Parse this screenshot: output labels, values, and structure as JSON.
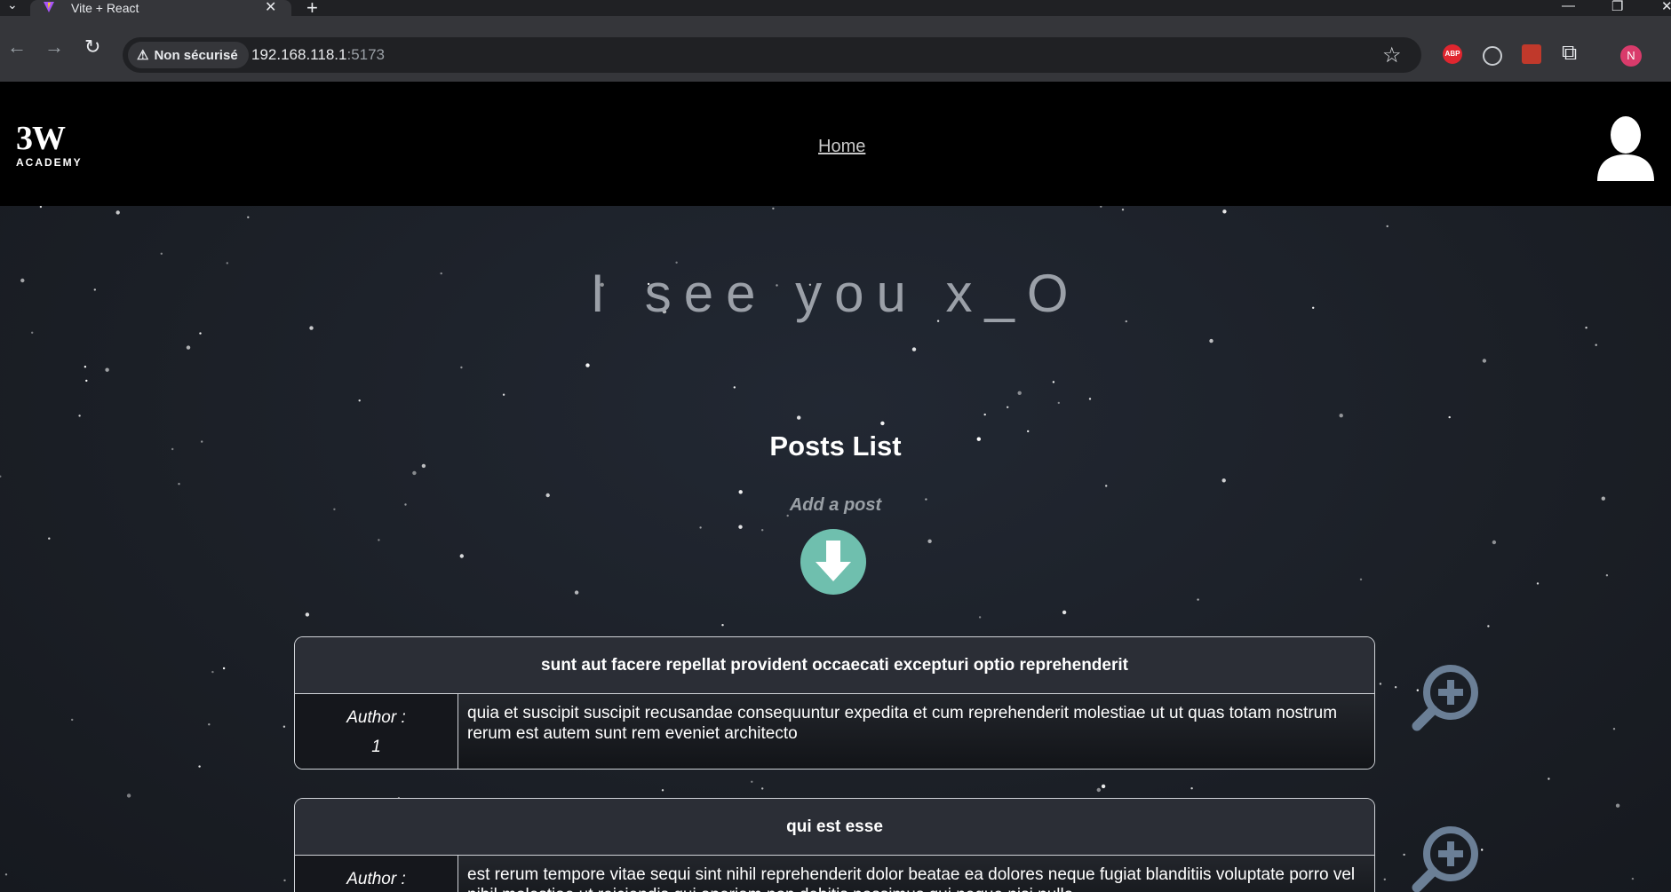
{
  "browser": {
    "tab_title": "Vite + React",
    "security_label": "Non sécurisé",
    "url_host": "192.168.118.1",
    "url_port": ":5173",
    "profile_initial": "N",
    "abp_label": "ABP"
  },
  "header": {
    "logo_mark": "3W",
    "logo_sub": "ACADEMY",
    "nav_home": "Home"
  },
  "hero": {
    "text": "I see you x_O"
  },
  "posts": {
    "title": "Posts List",
    "add_label": "Add a post",
    "items": [
      {
        "title": "sunt aut facere repellat provident occaecati excepturi optio reprehenderit",
        "author_label": "Author :",
        "author_id": "1",
        "body": "quia et suscipit suscipit recusandae consequuntur expedita et cum reprehenderit molestiae ut ut quas totam nostrum rerum est autem sunt rem eveniet architecto"
      },
      {
        "title": "qui est esse",
        "author_label": "Author :",
        "author_id": "",
        "body": "est rerum tempore vitae sequi sint nihil reprehenderit dolor beatae ea dolores neque fugiat blanditiis voluptate porro vel nihil molestiae ut reiciendis qui aperiam non debitis possimus qui neque nisi nulla"
      }
    ]
  },
  "colors": {
    "accent_button": "#6fbfae",
    "zoom_icon": "#6b7f96"
  }
}
